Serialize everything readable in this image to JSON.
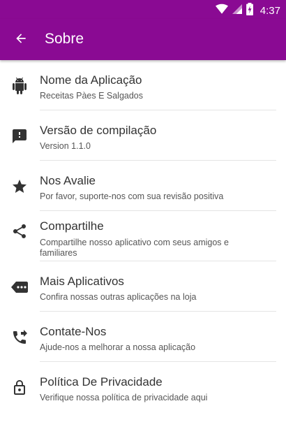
{
  "status_bar": {
    "time": "4:37",
    "icons": [
      "wifi-icon",
      "signal-icon",
      "battery-charging-icon"
    ]
  },
  "app_bar": {
    "title": "Sobre",
    "back_icon": "arrow-back-icon",
    "color": "#8a0a93"
  },
  "items": [
    {
      "icon": "android-icon",
      "title": "Nome da Aplicação",
      "subtitle": "Receitas Pàes E Salgados"
    },
    {
      "icon": "feedback-icon",
      "title": "Versão de compilação",
      "subtitle": "Version 1.1.0"
    },
    {
      "icon": "star-icon",
      "title": "Nos Avalie",
      "subtitle": "Por favor, suporte-nos com sua revisão positiva"
    },
    {
      "icon": "share-icon",
      "title": "Compartilhe",
      "subtitle": "Compartilhe nosso aplicativo com seus amigos e familiares"
    },
    {
      "icon": "more-apps-icon",
      "title": "Mais Aplicativos",
      "subtitle": "Confira nossas outras aplicações na loja"
    },
    {
      "icon": "phone-forward-icon",
      "title": "Contate-Nos",
      "subtitle": "Ajude-nos a melhorar a nossa aplicação"
    },
    {
      "icon": "lock-icon",
      "title": "Política De Privacidade",
      "subtitle": "Verifique nossa política de privacidade aqui"
    }
  ]
}
